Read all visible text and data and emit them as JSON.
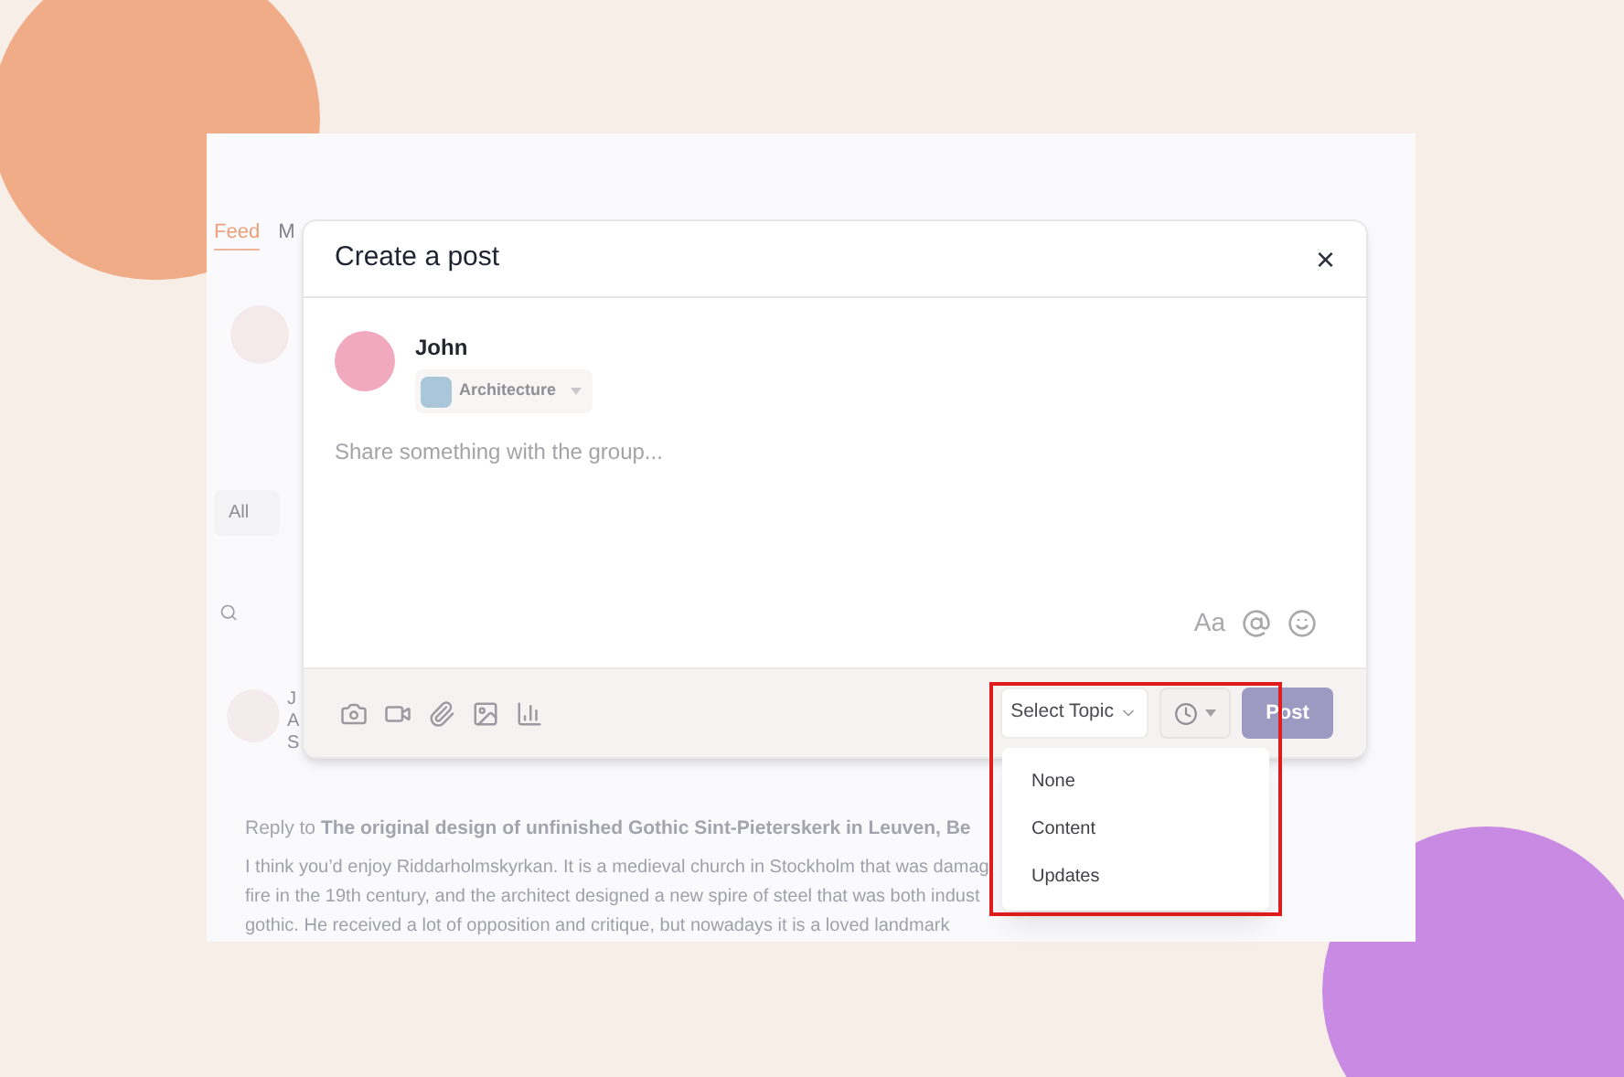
{
  "background_app": {
    "tabs": [
      {
        "label": "Feed",
        "selected": true
      },
      {
        "label": "M",
        "selected": false
      }
    ],
    "filter_chip": "All",
    "post": {
      "author": "J",
      "group": "A",
      "meta": "S"
    },
    "reply": {
      "text": "Reply to **The original design of unfinished Gothic Sint-Pieterskerk in Leuven, Be**",
      "lines": [
        "I think you’d enjoy Riddarholmskyrkan. It is a medieval church in Stockholm that was damag",
        "fire in the 19th century, and the architect designed a new spire of steel that was both indust",
        "gothic. He received a lot of opposition and critique, but nowadays it is a loved landmark"
      ]
    }
  },
  "modal": {
    "title": "Create a post",
    "close": "×",
    "user": "John",
    "group": "Architecture",
    "placeholder": "Share something with the group...",
    "format_label": "Aa",
    "topic_button": "Select Topic",
    "post_button": {
      "label": "Post",
      "disabled": true
    },
    "topic_menu": {
      "open": true,
      "options": [
        {
          "label": "None",
          "selected": false
        },
        {
          "label": "Content",
          "selected": false
        },
        {
          "label": "Updates",
          "selected": false
        }
      ]
    }
  }
}
